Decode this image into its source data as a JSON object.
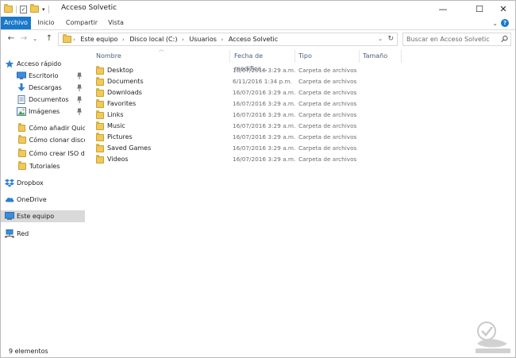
{
  "window": {
    "title": "Acceso Solvetic",
    "minimize": "—",
    "maximize": "☐",
    "close": "✕"
  },
  "ribbon": {
    "tabs": [
      {
        "label": "Archivo"
      },
      {
        "label": "Inicio"
      },
      {
        "label": "Compartir"
      },
      {
        "label": "Vista"
      }
    ],
    "expand": "⌄",
    "help": "?"
  },
  "nav": {
    "back": "←",
    "forward": "→",
    "recent": "⌄",
    "up": "↑"
  },
  "address": {
    "crumbs": [
      "Este equipo",
      "Disco local (C:)",
      "Usuarios",
      "Acceso Solvetic"
    ],
    "separator": "›",
    "dropdown": "⌄",
    "refresh": "↻"
  },
  "search": {
    "placeholder": "Buscar en Acceso Solvetic"
  },
  "sidebar": {
    "quick_access": "Acceso rápido",
    "items": [
      {
        "label": "Escritorio",
        "icon": "desktop-icon",
        "pinned": true
      },
      {
        "label": "Descargas",
        "icon": "download-arrow-icon",
        "pinned": true
      },
      {
        "label": "Documentos",
        "icon": "documents-icon",
        "pinned": true
      },
      {
        "label": "Imágenes",
        "icon": "pictures-icon",
        "pinned": true
      },
      {
        "label": "Cómo añadir Quick",
        "icon": "folder-icon",
        "pinned": false
      },
      {
        "label": "Cómo clonar disco",
        "icon": "folder-icon",
        "pinned": false
      },
      {
        "label": "Cómo crear ISO de",
        "icon": "folder-icon",
        "pinned": false
      },
      {
        "label": "Tutoriales",
        "icon": "folder-icon",
        "pinned": false
      }
    ],
    "dropbox": "Dropbox",
    "onedrive": "OneDrive",
    "this_pc": "Este equipo",
    "network": "Red"
  },
  "columns": {
    "name": "Nombre",
    "date": "Fecha de modifica...",
    "type": "Tipo",
    "size": "Tamaño"
  },
  "files": [
    {
      "name": "Desktop",
      "date": "16/07/2016 3:29 a.m.",
      "type": "Carpeta de archivos",
      "size": ""
    },
    {
      "name": "Documents",
      "date": "6/11/2016 1:34 p.m.",
      "type": "Carpeta de archivos",
      "size": ""
    },
    {
      "name": "Downloads",
      "date": "16/07/2016 3:29 a.m.",
      "type": "Carpeta de archivos",
      "size": ""
    },
    {
      "name": "Favorites",
      "date": "16/07/2016 3:29 a.m.",
      "type": "Carpeta de archivos",
      "size": ""
    },
    {
      "name": "Links",
      "date": "16/07/2016 3:29 a.m.",
      "type": "Carpeta de archivos",
      "size": ""
    },
    {
      "name": "Music",
      "date": "16/07/2016 3:29 a.m.",
      "type": "Carpeta de archivos",
      "size": ""
    },
    {
      "name": "Pictures",
      "date": "16/07/2016 3:29 a.m.",
      "type": "Carpeta de archivos",
      "size": ""
    },
    {
      "name": "Saved Games",
      "date": "16/07/2016 3:29 a.m.",
      "type": "Carpeta de archivos",
      "size": ""
    },
    {
      "name": "Videos",
      "date": "16/07/2016 3:29 a.m.",
      "type": "Carpeta de archivos",
      "size": ""
    }
  ],
  "status": {
    "count": "9 elementos"
  },
  "colors": {
    "accent": "#1979ca",
    "folder": "#f0c95a",
    "selected": "#d9d9d9"
  }
}
